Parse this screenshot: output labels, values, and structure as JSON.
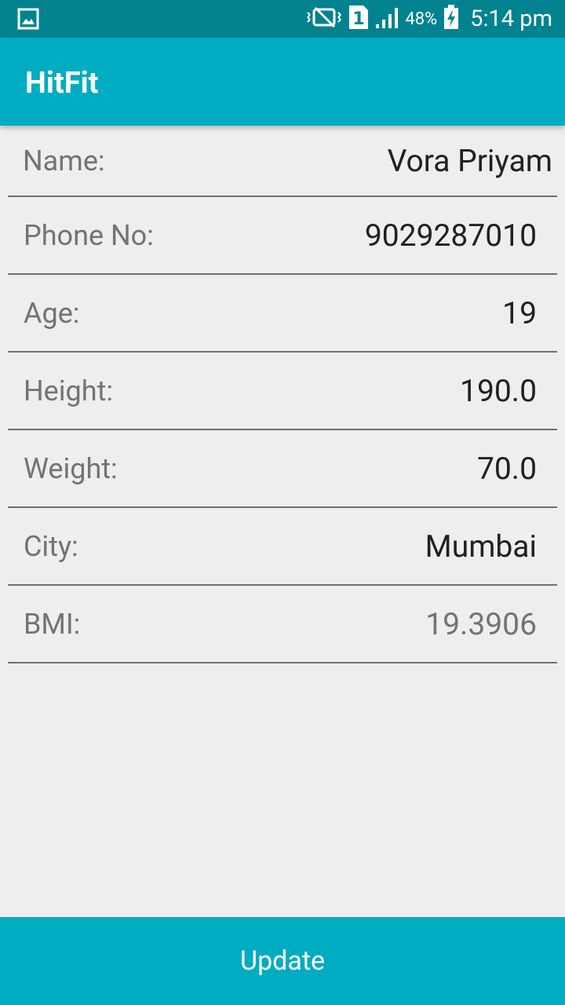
{
  "status_bar": {
    "battery_percent": "48%",
    "time": "5:14 pm",
    "sim_slot": "1"
  },
  "app_bar": {
    "title": "HitFit"
  },
  "profile": {
    "fields": [
      {
        "label": "Name:",
        "value": "Vora Priyam"
      },
      {
        "label": "Phone No:",
        "value": "9029287010"
      },
      {
        "label": "Age:",
        "value": "19"
      },
      {
        "label": "Height:",
        "value": "190.0"
      },
      {
        "label": "Weight:",
        "value": "70.0"
      },
      {
        "label": "City:",
        "value": "Mumbai"
      },
      {
        "label": "BMI:",
        "value": "19.3906"
      }
    ]
  },
  "actions": {
    "update_label": "Update"
  },
  "colors": {
    "status_bar": "#00838f",
    "primary": "#00acc1",
    "background": "#eeeeee",
    "label_text": "#737373",
    "value_text": "#212121"
  }
}
